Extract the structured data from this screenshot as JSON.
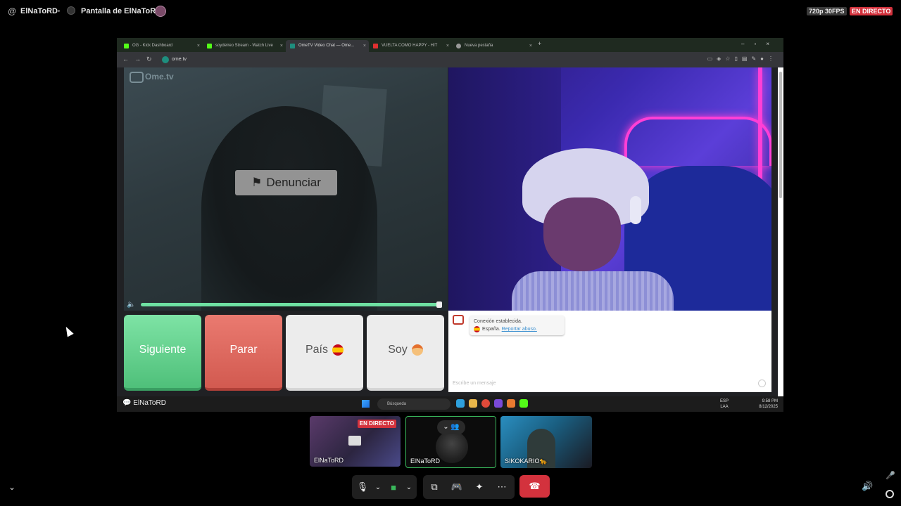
{
  "header": {
    "username": "ElNaToRD",
    "screen_title": "Pantalla de ElNaToRD",
    "quality": "720p 30FPS",
    "live": "EN DIRECTO"
  },
  "browser": {
    "tabs": [
      {
        "label": "OG - Kick Dashboard",
        "fav": "kick-icon"
      },
      {
        "label": "soydelreo Stream - Watch Live",
        "fav": "kick-icon"
      },
      {
        "label": "OmeTV Video Chat — Ome...",
        "fav": "ometv-icon"
      },
      {
        "label": "VUELTA COMO HAPPY - HIT",
        "fav": "youtube-icon"
      },
      {
        "label": "Nueva pestaña",
        "fav": "globe-icon"
      }
    ],
    "url": "ome.tv"
  },
  "ometv": {
    "logo": "Ome.tv",
    "report_label": "Denunciar",
    "next_label": "Siguiente",
    "stop_label": "Parar",
    "country_label": "País",
    "me_label": "Soy",
    "chat_connected": "Conexión establecida.",
    "chat_country": "España.",
    "chat_report_link": "Reportar abuso.",
    "chat_placeholder": "Escribe un mensaje",
    "volume": 1.0
  },
  "taskbar": {
    "streamer_label": "ElNaToRD",
    "search_placeholder": "Búsqueda",
    "lang": "ESP LAA",
    "time": "9:58 PM",
    "date": "8/12/2025"
  },
  "participants": [
    {
      "name": "ElNaToRD",
      "badge": "EN DIRECTO"
    },
    {
      "name": "ElNaToRD"
    },
    {
      "name": "SIKOKARIO🐆"
    }
  ],
  "colors": {
    "accent_green": "#6ee0a2",
    "live_red": "#d3323d",
    "next_green": "#4fc07a",
    "stop_red": "#d25a50"
  }
}
